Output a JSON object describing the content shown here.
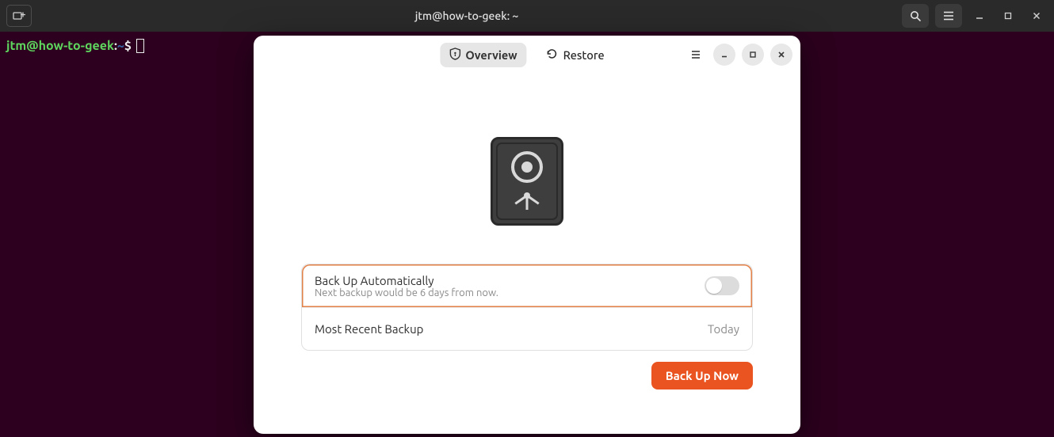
{
  "terminal": {
    "title": "jtm@how-to-geek: ~",
    "prompt_user": "jtm@how-to-geek",
    "prompt_colon": ":",
    "prompt_path": "~",
    "prompt_dollar": "$"
  },
  "backup": {
    "tabs": {
      "overview": "Overview",
      "restore": "Restore"
    },
    "auto": {
      "title": "Back Up Automatically",
      "subtitle": "Next backup would be 6 days from now.",
      "enabled": false
    },
    "recent": {
      "label": "Most Recent Backup",
      "value": "Today"
    },
    "action_label": "Back Up Now"
  },
  "colors": {
    "accent": "#e95420",
    "terminal_bg": "#2c001e"
  }
}
